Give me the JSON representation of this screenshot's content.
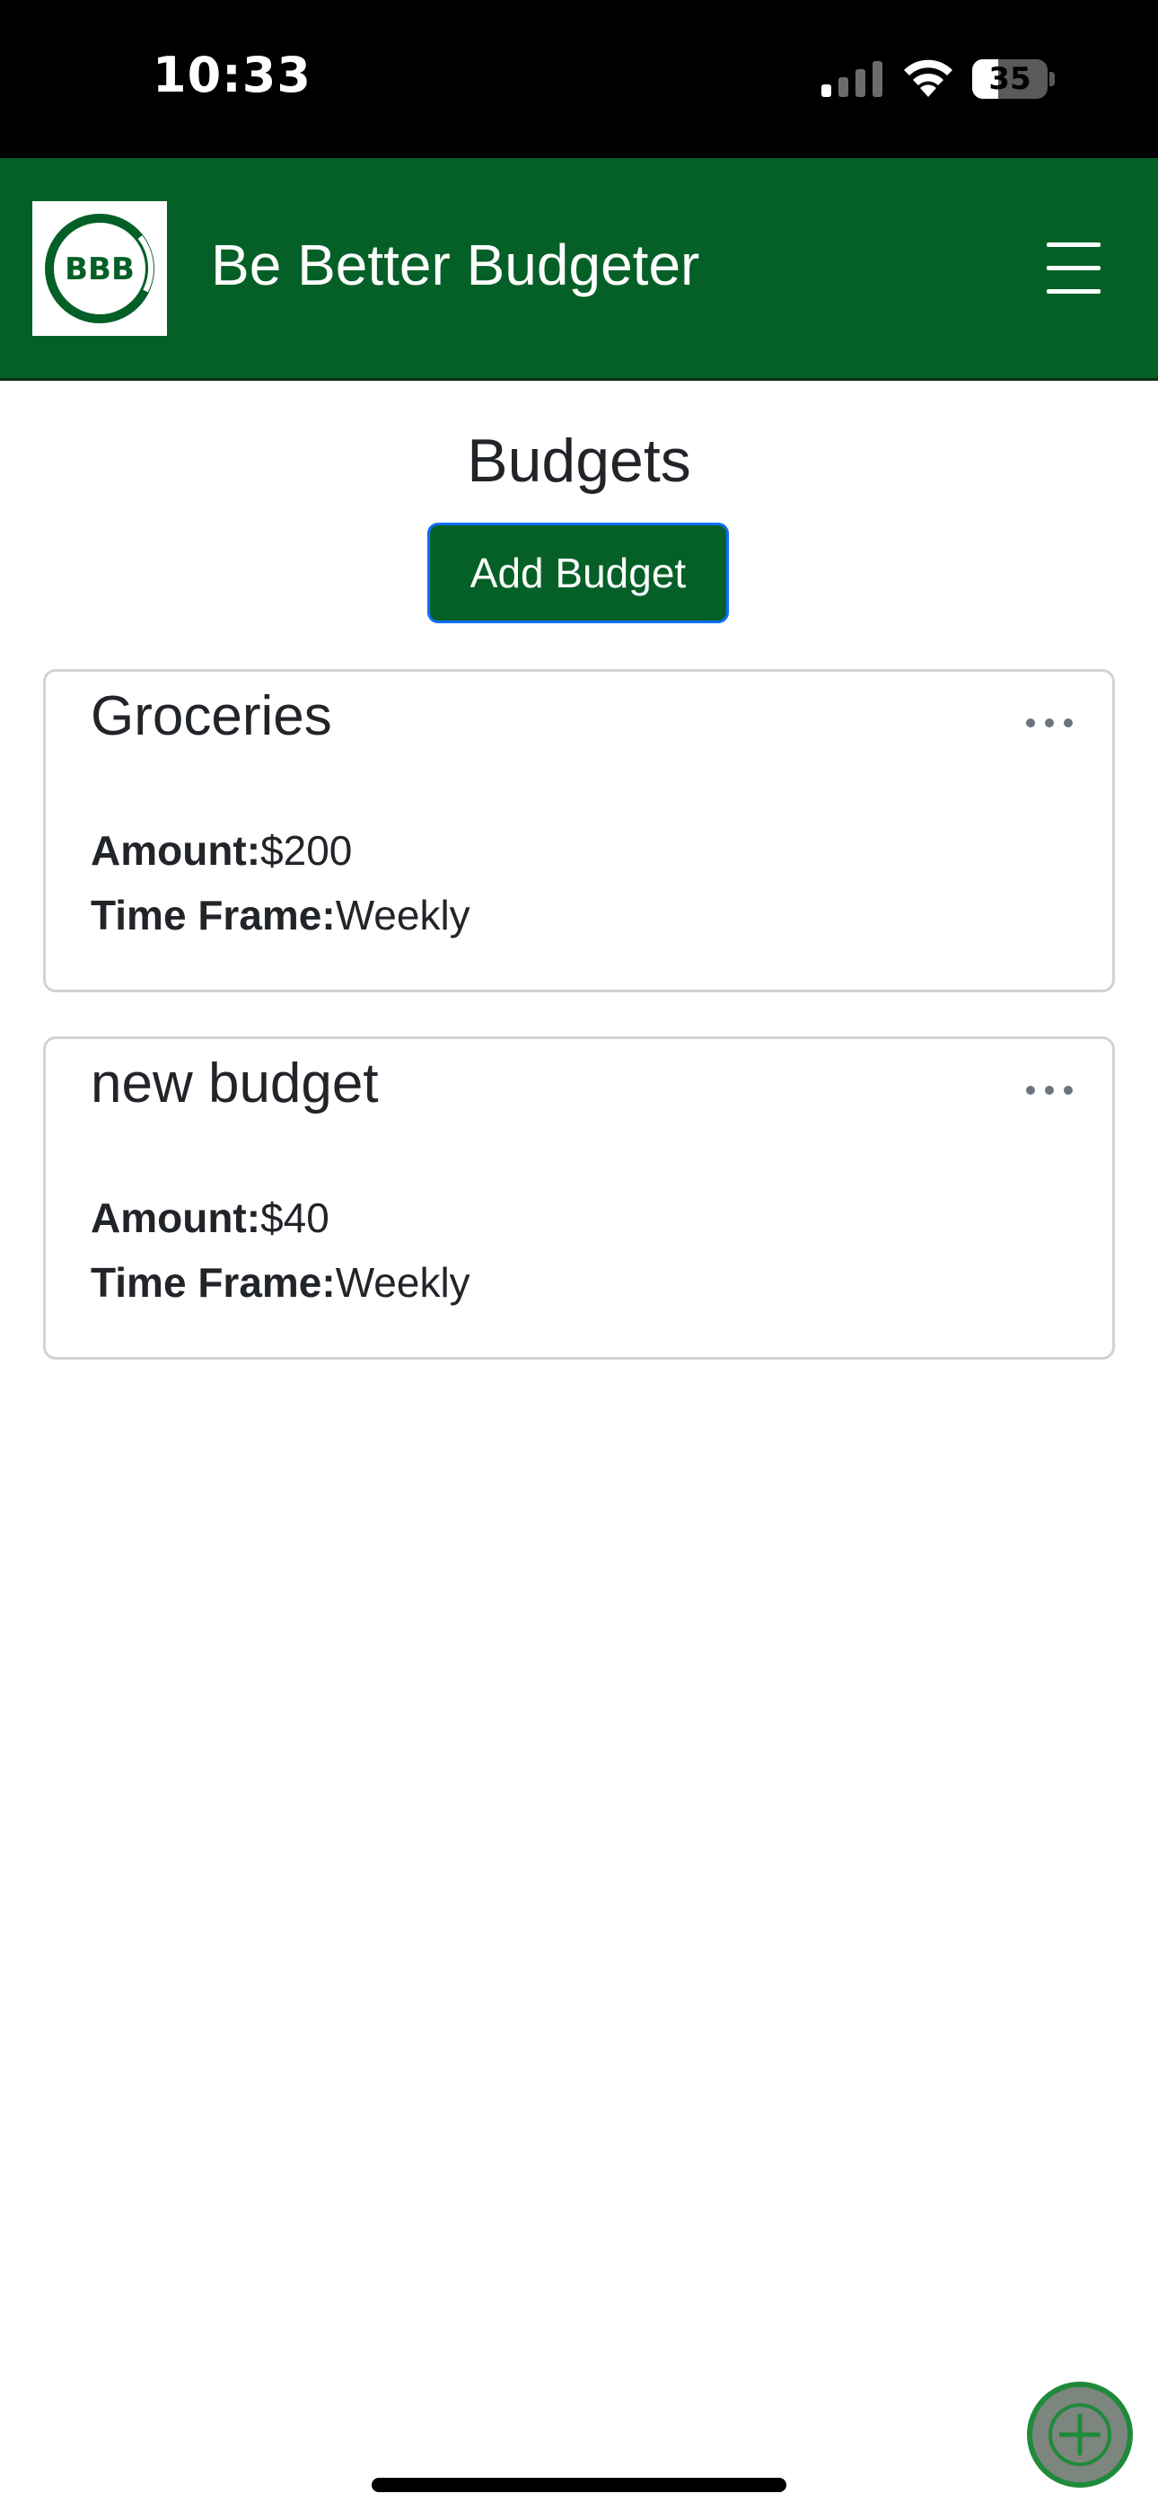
{
  "status_bar": {
    "time": "10:33",
    "battery_level": "35",
    "battery_fraction": 0.35
  },
  "navbar": {
    "logo_text": "BBB",
    "title": "Be Better Budgeter",
    "menu_icon": "hamburger-menu-icon"
  },
  "main": {
    "title": "Budgets",
    "add_button_label": "Add Budget",
    "budgets": [
      {
        "name": "Groceries",
        "amount_label": "Amount:",
        "amount_value": "$200",
        "timeframe_label": "Time Frame:",
        "timeframe_value": "Weekly"
      },
      {
        "name": "new budget",
        "amount_label": "Amount:",
        "amount_value": "$40",
        "timeframe_label": "Time Frame:",
        "timeframe_value": "Weekly"
      }
    ]
  },
  "fab": {
    "icon": "plus-icon"
  },
  "colors": {
    "brand_green": "#056027",
    "accent_blue": "#0d6efd",
    "fab_gray": "#7d857f",
    "fab_green": "#1f8a3a"
  }
}
